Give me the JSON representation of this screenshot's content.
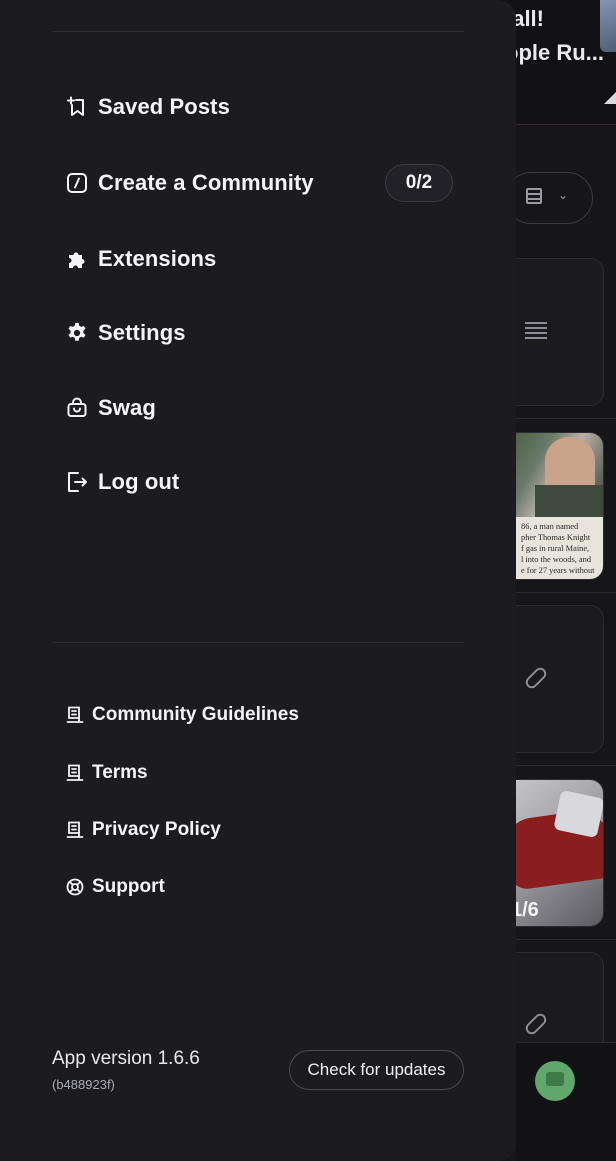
{
  "background": {
    "post_title_line1": "all!",
    "post_title_line2": "ople Ru...",
    "news_text": [
      "86, a man named",
      "pher Thomas Knight",
      "f gas in rural Maine,",
      "l into the woods, and",
      "e for 27 years without"
    ],
    "gallery_counter": "1/6"
  },
  "menu": {
    "items": [
      {
        "label": "Saved Posts",
        "icon": "bookmark-plus-icon"
      },
      {
        "label": "Create a Community",
        "icon": "create-community-icon",
        "badge": "0/2"
      },
      {
        "label": "Extensions",
        "icon": "puzzle-icon"
      },
      {
        "label": "Settings",
        "icon": "gear-icon"
      },
      {
        "label": "Swag",
        "icon": "shopping-bag-icon"
      },
      {
        "label": "Log out",
        "icon": "logout-icon"
      }
    ]
  },
  "footer_links": [
    {
      "label": "Community Guidelines",
      "icon": "document-icon"
    },
    {
      "label": "Terms",
      "icon": "document-icon"
    },
    {
      "label": "Privacy Policy",
      "icon": "document-icon"
    },
    {
      "label": "Support",
      "icon": "lifebuoy-icon"
    }
  ],
  "app": {
    "version": "App version 1.6.6",
    "build": "(b488923f)",
    "check_updates_label": "Check for updates"
  },
  "colors": {
    "drawer_bg": "#1b1b20",
    "page_bg": "#16161a",
    "text": "#f4f4f6",
    "muted": "#a9a9b3",
    "border": "#3b3b44"
  }
}
